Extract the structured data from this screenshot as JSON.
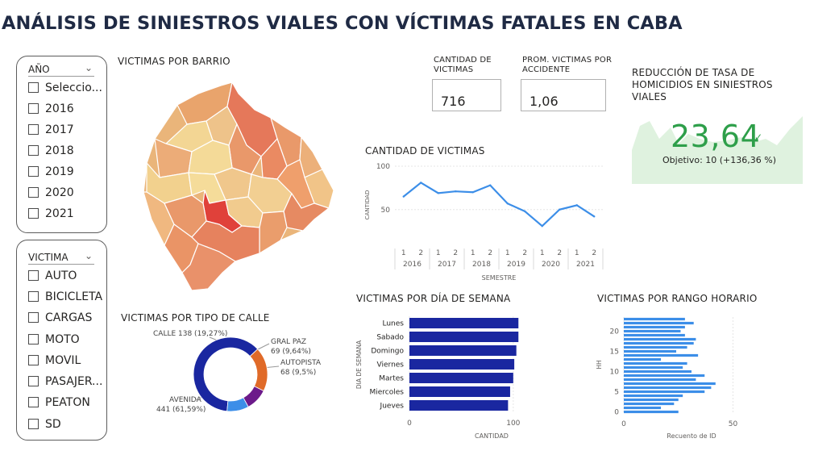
{
  "header": {
    "title": "ANÁLISIS DE SINIESTROS VIALES CON VÍCTIMAS FATALES EN CABA"
  },
  "slicer_year": {
    "label": "AÑO",
    "options": [
      "Seleccio...",
      "2016",
      "2017",
      "2018",
      "2019",
      "2020",
      "2021"
    ]
  },
  "slicer_victim": {
    "label": "VICTIMA",
    "options": [
      "AUTO",
      "BICICLETA",
      "CARGAS",
      "MOTO",
      "MOVIL",
      "PASAJER...",
      "PEATON",
      "SD"
    ]
  },
  "map": {
    "title": "VICTIMAS POR BARRIO"
  },
  "cards": {
    "total_label": "CANTIDAD DE VICTIMAS",
    "total_value": "716",
    "avg_label": "PROM. VICTIMAS POR ACCIDENTE",
    "avg_value": "1,06"
  },
  "kpi": {
    "title": "REDUCCIÓN DE TASA DE HOMICIDIOS EN SINIESTROS VIALES",
    "value": "23,64",
    "check": "✓",
    "goal": "Objetivo: 10 (+136,36 %)",
    "value_color": "#2e9f4a",
    "area_color": "#dff2df"
  },
  "donut": {
    "title": "VICTIMAS POR TIPO DE CALLE",
    "labels": {
      "calle": "CALLE 138 (19,27%)",
      "gralpaz_1": "GRAL PAZ",
      "gralpaz_2": "69 (9,64%)",
      "autopista_1": "AUTOPISTA",
      "autopista_2": "68 (9,5%)",
      "avenida_1": "AVENIDA",
      "avenida_2": "441 (61,59%)"
    }
  },
  "line_chart": {
    "title": "CANTIDAD DE VICTIMAS"
  },
  "dow_chart": {
    "title": "VICTIMAS POR DÍA DE SEMANA"
  },
  "hour_chart": {
    "title": "VICTIMAS POR RANGO HORARIO"
  },
  "chart_data": [
    {
      "id": "line",
      "type": "line",
      "x": [
        "2016-1",
        "2016-2",
        "2017-1",
        "2017-2",
        "2018-1",
        "2018-2",
        "2019-1",
        "2019-2",
        "2020-1",
        "2020-2",
        "2021-1",
        "2021-2"
      ],
      "x_sub": [
        "1",
        "2",
        "1",
        "2",
        "1",
        "2",
        "1",
        "2",
        "1",
        "2",
        "1",
        "2"
      ],
      "x_groups": [
        "2016",
        "2017",
        "2018",
        "2019",
        "2020",
        "2021"
      ],
      "values": [
        65,
        81,
        69,
        71,
        70,
        78,
        57,
        48,
        31,
        50,
        55,
        42
      ],
      "ylabel": "CANTIDAD",
      "xlabel": "SEMESTRE",
      "yticks": [
        50,
        100
      ],
      "ylim": [
        20,
        100
      ],
      "color": "#3c8ee8"
    },
    {
      "id": "dow",
      "type": "bar",
      "orientation": "horizontal",
      "categories": [
        "Lunes",
        "Sabado",
        "Domingo",
        "Viernes",
        "Martes",
        "Miercoles",
        "Jueves"
      ],
      "values": [
        105,
        105,
        103,
        101,
        100,
        97,
        95
      ],
      "xlabel": "CANTIDAD",
      "ylabel": "DIA DE SEMANA",
      "xticks": [
        0,
        100
      ],
      "xlim": [
        0,
        118
      ],
      "color": "#1a27a0"
    },
    {
      "id": "hour",
      "type": "bar",
      "orientation": "horizontal",
      "categories": [
        "23",
        "22",
        "21",
        "20",
        "19",
        "18",
        "17",
        "16",
        "15",
        "14",
        "13",
        "12",
        "11",
        "10",
        "9",
        "8",
        "7",
        "6",
        "5",
        "4",
        "3",
        "2",
        "1",
        "0"
      ],
      "values": [
        28,
        32,
        28,
        26,
        28,
        33,
        32,
        29,
        24,
        34,
        17,
        29,
        27,
        31,
        37,
        33,
        42,
        40,
        37,
        27,
        25,
        23,
        17,
        25
      ],
      "xlabel": "Recuento de ID",
      "ylabel": "HH",
      "xticks": [
        0,
        50
      ],
      "yticks": [
        "20",
        "15",
        "10",
        "5",
        "0"
      ],
      "xlim": [
        0,
        62
      ],
      "color": "#3c8ee8"
    },
    {
      "id": "donut",
      "type": "pie",
      "categories": [
        "AVENIDA",
        "CALLE",
        "GRAL PAZ",
        "AUTOPISTA"
      ],
      "values": [
        441,
        138,
        69,
        68
      ],
      "colors": [
        "#1a27a0",
        "#e06a28",
        "#6c1a8a",
        "#3c8ee8"
      ]
    }
  ]
}
